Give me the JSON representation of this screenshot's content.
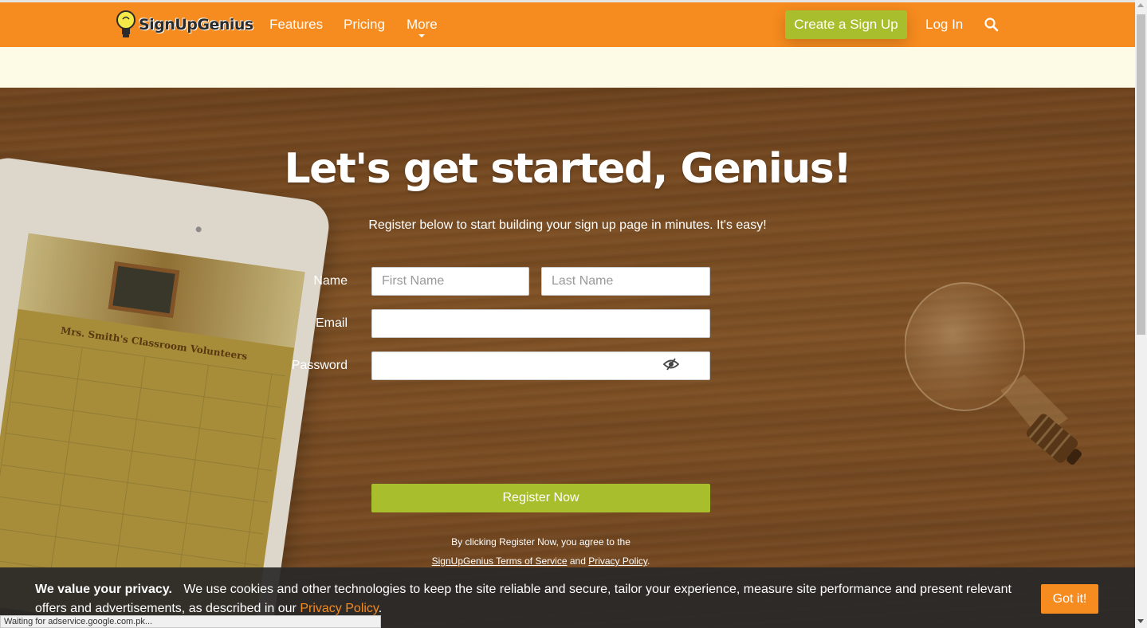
{
  "header": {
    "logo_text": "SignUpGenius",
    "nav": [
      "Features",
      "Pricing",
      "More"
    ],
    "create_label": "Create a Sign Up",
    "login_label": "Log In",
    "search_icon": "search-icon"
  },
  "hero": {
    "title": "Let's get started, Genius!",
    "subtitle": "Register below to start building your sign up page in minutes. It's easy!",
    "tablet_title": "Mrs. Smith's Classroom Volunteers"
  },
  "form": {
    "name_label": "Name",
    "first_name_placeholder": "First Name",
    "last_name_placeholder": "Last Name",
    "email_label": "Email",
    "email_value": "",
    "password_label": "Password",
    "password_value": "",
    "show_password_icon": "eye-icon",
    "register_label": "Register Now",
    "terms_prefix": "By clicking Register Now, you agree to the",
    "terms_link": "SignUpGenius Terms of Service",
    "terms_and": "and",
    "privacy_link": "Privacy Policy",
    "terms_end": "."
  },
  "cookie": {
    "heading": "We value your privacy.",
    "text": "We use cookies and other technologies to keep the site reliable and secure, tailor your experience, measure site performance and present relevant offers and advertisements, as described in our",
    "link": "Privacy Policy",
    "end": ".",
    "button": "Got it!"
  },
  "status": {
    "text": "Waiting for adservice.google.com.pk..."
  },
  "colors": {
    "brand_orange": "#f68b1f",
    "accent_green": "#a8be2d"
  }
}
